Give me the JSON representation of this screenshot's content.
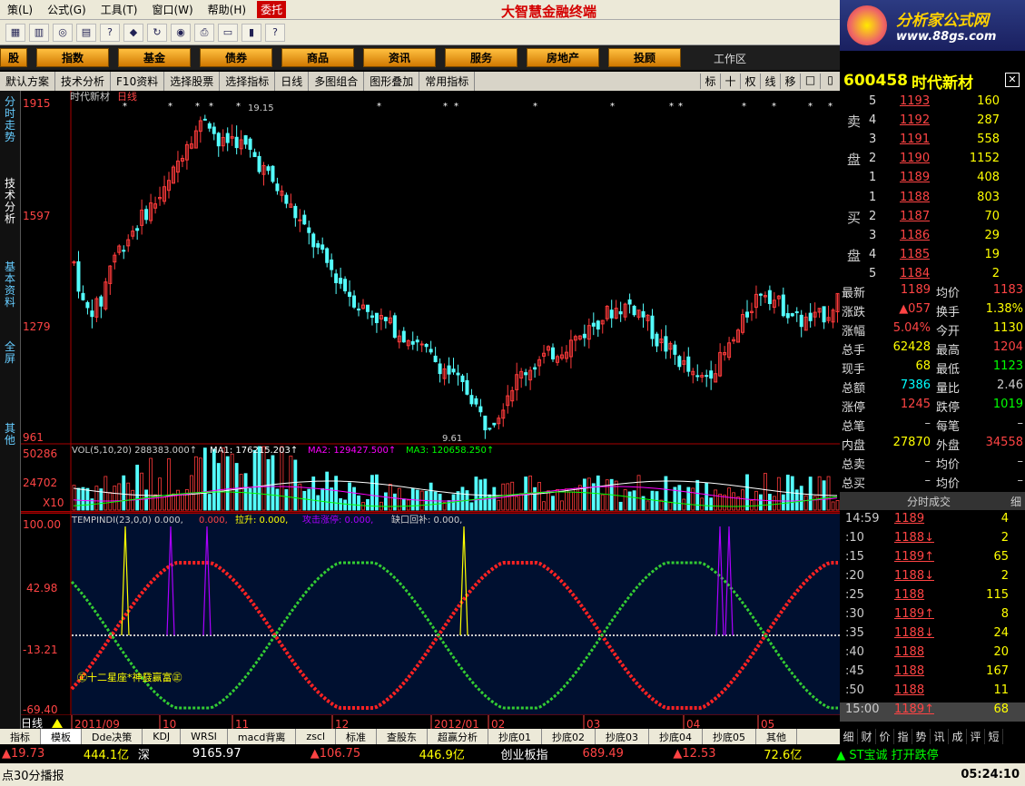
{
  "menu": {
    "items": [
      "策(L)",
      "公式(G)",
      "工具(T)",
      "窗口(W)",
      "帮助(H)"
    ],
    "weituo": "委托",
    "app_title": "大智慧金融终端"
  },
  "logo": {
    "line1": "分析家公式网",
    "line2": "www.88gs.com"
  },
  "categories": [
    "股",
    "指数",
    "基金",
    "债券",
    "商品",
    "资讯",
    "服务",
    "房地产",
    "投顾"
  ],
  "workarea": "工作区",
  "subbar": {
    "items": [
      "默认方案",
      "技术分析",
      "F10资料",
      "选择股票",
      "选择指标",
      "日线",
      "多图组合",
      "图形叠加",
      "常用指标"
    ],
    "right": [
      "标",
      "十",
      "权",
      "线",
      "移",
      "□",
      "▯"
    ]
  },
  "stock": {
    "code": "600458",
    "name": "时代新材",
    "period": "日线"
  },
  "left_tabs": [
    "分时走势",
    "技术分析",
    "基本资料",
    "全屏",
    "其他"
  ],
  "price_axis": [
    "1915",
    "1597",
    "1279",
    "961"
  ],
  "price_high": "19.15",
  "price_low": "9.61",
  "vol_axis": [
    "50286",
    "24702",
    "X10"
  ],
  "vol_line": {
    "head": "VOL(5,10,20) 288383.000↑",
    "ma1": "MA1: 176215.203↑",
    "ma2": "MA2: 129427.500↑",
    "ma3": "MA3: 120658.250↑"
  },
  "ind_axis": [
    "100.00",
    "42.98",
    "-13.21",
    "-69.40"
  ],
  "ind_line": {
    "head": "TEMPINDI(23,0,0) 0.000,",
    "v1": "0.000,",
    "v2": "拉升: 0.000,",
    "v3": "攻击涨停: 0.000,",
    "v4": "缺口回补: 0.000,"
  },
  "watermark": "㊣十二星座*神鼗赢富㊣",
  "date_axis": [
    "2011/09",
    "10",
    "11",
    "12",
    "2012/01",
    "02",
    "03",
    "04",
    "05"
  ],
  "daily_label": "日线",
  "colors": {
    "up": "#ff3b3b",
    "down": "#54ffff",
    "ma1": "#ffffff",
    "ma2": "#ff00ff",
    "ma3": "#00ff00",
    "accent": "#ffff00"
  },
  "sell": [
    {
      "i": "5",
      "p": "1193",
      "v": "160"
    },
    {
      "i": "4",
      "p": "1192",
      "v": "287"
    },
    {
      "i": "3",
      "p": "1191",
      "v": "558"
    },
    {
      "i": "2",
      "p": "1190",
      "v": "1152"
    },
    {
      "i": "1",
      "p": "1189",
      "v": "408"
    }
  ],
  "buy": [
    {
      "i": "1",
      "p": "1188",
      "v": "803"
    },
    {
      "i": "2",
      "p": "1187",
      "v": "70"
    },
    {
      "i": "3",
      "p": "1186",
      "v": "29"
    },
    {
      "i": "4",
      "p": "1185",
      "v": "19"
    },
    {
      "i": "5",
      "p": "1184",
      "v": "2"
    }
  ],
  "side": {
    "sell": [
      "卖",
      "盘"
    ],
    "buy": [
      "买",
      "盘"
    ]
  },
  "quotes": [
    {
      "a": "最新",
      "av": "1189",
      "b": "均价",
      "bv": "1183"
    },
    {
      "a": "涨跌",
      "av": "▲057",
      "b": "换手",
      "bv": "1.38%"
    },
    {
      "a": "涨幅",
      "av": "5.04%",
      "b": "今开",
      "bv": "1130"
    },
    {
      "a": "总手",
      "av": "62428",
      "b": "最高",
      "bv": "1204"
    },
    {
      "a": "现手",
      "av": "68",
      "b": "最低",
      "bv": "1123"
    },
    {
      "a": "总额",
      "av": "7386",
      "b": "量比",
      "bv": "2.46"
    },
    {
      "a": "涨停",
      "av": "1245",
      "b": "跌停",
      "bv": "1019"
    },
    {
      "a": "总笔",
      "av": "–",
      "b": "每笔",
      "bv": "–"
    },
    {
      "a": "内盘",
      "av": "27870",
      "b": "外盘",
      "bv": "34558"
    },
    {
      "a": "总卖",
      "av": "–",
      "b": "均价",
      "bv": "–"
    },
    {
      "a": "总买",
      "av": "–",
      "b": "均价",
      "bv": "–"
    }
  ],
  "ticks_header": "分时成交",
  "ticks_header_right": "细",
  "ticks": [
    {
      "t": "14:59",
      "p": "1189",
      "v": "4"
    },
    {
      "t": ":10",
      "p": "1188↓",
      "v": "2"
    },
    {
      "t": ":15",
      "p": "1189↑",
      "v": "65"
    },
    {
      "t": ":20",
      "p": "1188↓",
      "v": "2"
    },
    {
      "t": ":25",
      "p": "1188",
      "v": "115"
    },
    {
      "t": ":30",
      "p": "1189↑",
      "v": "8"
    },
    {
      "t": ":35",
      "p": "1188↓",
      "v": "24"
    },
    {
      "t": ":40",
      "p": "1188",
      "v": "20"
    },
    {
      "t": ":45",
      "p": "1188",
      "v": "167"
    },
    {
      "t": ":50",
      "p": "1188",
      "v": "11"
    },
    {
      "t": "15:00",
      "p": "1189↑",
      "v": "68"
    }
  ],
  "bottom_tabs": [
    "指标",
    "模板",
    "Dde决策",
    "KDJ",
    "WRSI",
    "macd背离",
    "zscl",
    "标准",
    "查股东",
    "超赢分析",
    "抄底01",
    "抄底02",
    "抄底03",
    "抄底04",
    "抄底05",
    "其他"
  ],
  "right_tabs": [
    "细",
    "财",
    "价",
    "指",
    "势",
    "讯",
    "成",
    "评",
    "短"
  ],
  "ticker": [
    "▲19.73",
    "444.1亿",
    "深",
    "9165.97",
    "▲106.75",
    "446.9亿",
    "创业板指",
    "689.49",
    "▲12.53",
    "72.6亿",
    "▲ ST宝诚  打开跌停"
  ],
  "status": {
    "left": "点30分播报",
    "time": "05:24:10"
  }
}
